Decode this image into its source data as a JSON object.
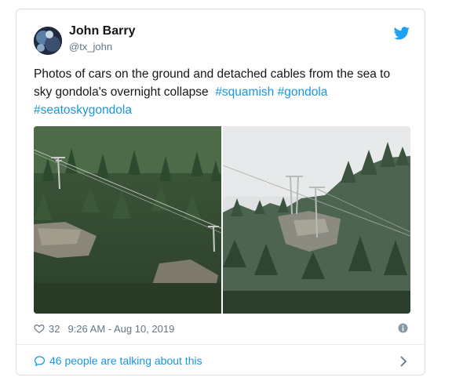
{
  "author": {
    "name": "John Barry",
    "handle": "@tx_john"
  },
  "tweet": {
    "text": "Photos of cars on the ground and detached cables from the sea to sky gondola's overnight collapse",
    "hashtags": [
      "#squamish",
      "#gondola",
      "#seatoskygondola"
    ]
  },
  "footer": {
    "likes": "32",
    "timestamp": "9:26 AM - Aug 10, 2019",
    "talking": "46 people are talking about this"
  },
  "colors": {
    "link": "#1b95e0",
    "muted": "#657786",
    "border": "#d9dfe4"
  },
  "icons": {
    "brand": "twitter-bird-icon",
    "like": "heart-icon",
    "info": "info-icon",
    "conversation": "speech-bubble-icon",
    "more": "chevron-right-icon"
  }
}
